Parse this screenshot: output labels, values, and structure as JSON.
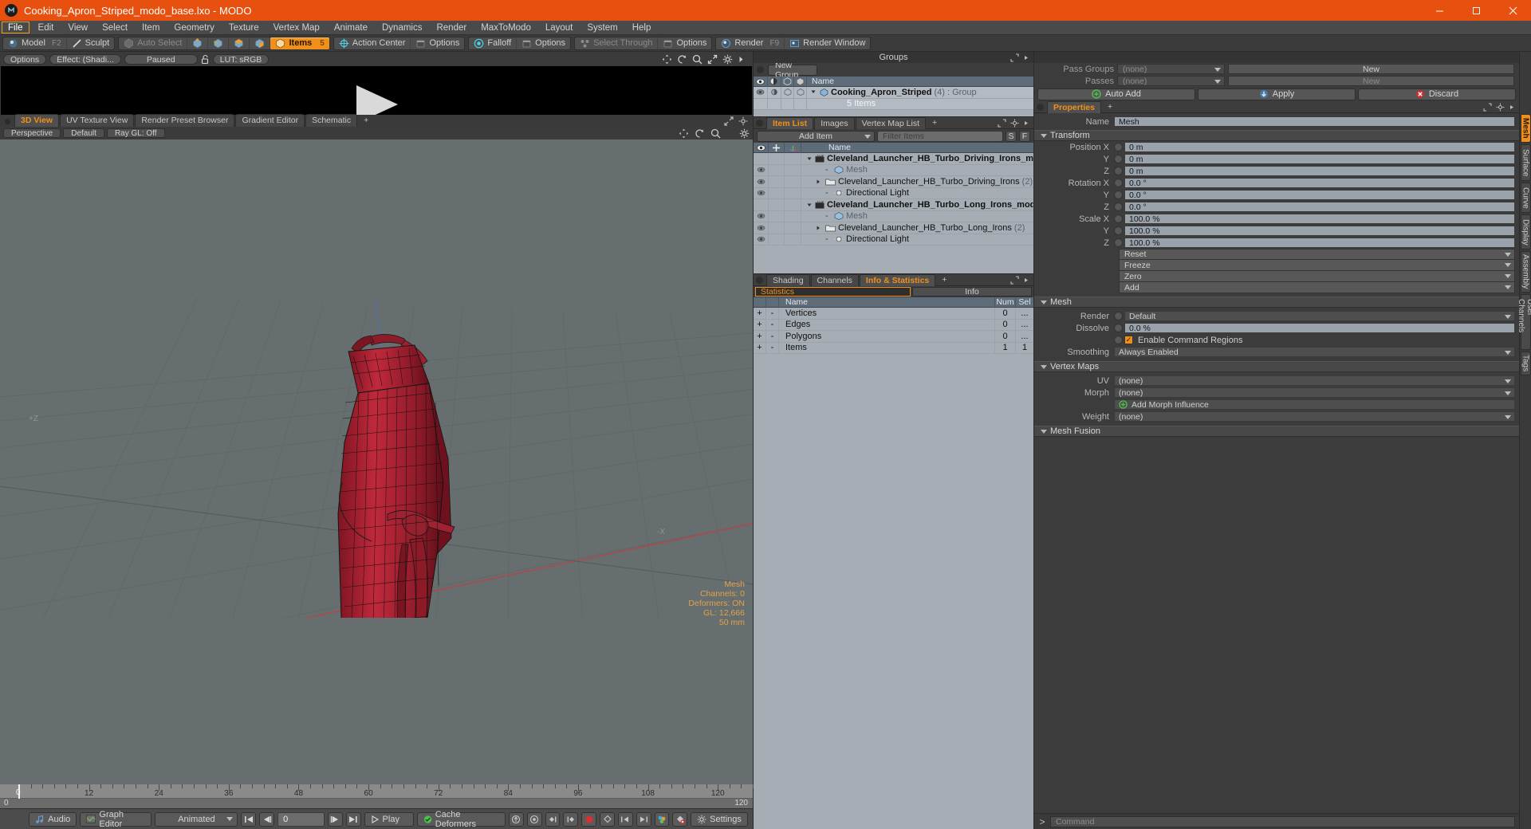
{
  "window": {
    "title": "Cooking_Apron_Striped_modo_base.lxo - MODO",
    "minimize": "–",
    "maximize": "❐",
    "close": "✕"
  },
  "menu": {
    "items": [
      "File",
      "Edit",
      "View",
      "Select",
      "Item",
      "Geometry",
      "Texture",
      "Vertex Map",
      "Animate",
      "Dynamics",
      "Render",
      "MaxToModo",
      "Layout",
      "System",
      "Help"
    ],
    "active": "File"
  },
  "modebar": {
    "model": "Model",
    "model_key": "F2",
    "sculpt": "Sculpt",
    "auto_select": "Auto Select",
    "items": "Items",
    "items_count": "5",
    "action_center": "Action Center",
    "options1": "Options",
    "falloff": "Falloff",
    "options2": "Options",
    "select_through": "Select Through",
    "options3": "Options",
    "render": "Render",
    "render_key": "F9",
    "render_window": "Render Window"
  },
  "render_preview": {
    "options": "Options",
    "effect": "Effect: (Shadi...",
    "paused": "Paused",
    "lut": "LUT: sRGB"
  },
  "viewport_tabs": {
    "tabs": [
      "3D View",
      "UV Texture View",
      "Render Preset Browser",
      "Gradient Editor",
      "Schematic"
    ],
    "selected": "3D View",
    "plus": "+"
  },
  "viewport_header": {
    "perspective": "Perspective",
    "shading_default": "Default",
    "raygl": "Ray GL: Off"
  },
  "viewport": {
    "axis_label_z": "+Z",
    "axis_label_x": "-X",
    "status_title": "Mesh",
    "status_lines": [
      "Channels: 0",
      "Deformers: ON",
      "GL: 12,666",
      "50 mm"
    ]
  },
  "timeline": {
    "ticks": [
      {
        "value": "0",
        "pos": 0
      },
      {
        "value": "12",
        "pos": 12
      },
      {
        "value": "24",
        "pos": 24
      },
      {
        "value": "36",
        "pos": 36
      },
      {
        "value": "48",
        "pos": 48
      },
      {
        "value": "60",
        "pos": 60
      },
      {
        "value": "72",
        "pos": 72
      },
      {
        "value": "84",
        "pos": 84
      },
      {
        "value": "96",
        "pos": 96
      },
      {
        "value": "108",
        "pos": 108
      },
      {
        "value": "120",
        "pos": 120
      }
    ],
    "range_start": "0",
    "range_end": "120",
    "playhead": "0"
  },
  "bottombar": {
    "audio": "Audio",
    "graph_editor": "Graph Editor",
    "mode": "Animated",
    "frame": "0",
    "play": "Play",
    "cache_deformers": "Cache Deformers",
    "settings": "Settings"
  },
  "groups_panel": {
    "title": "Groups",
    "new_group": "New Group",
    "columns": [
      "Name"
    ],
    "item_name": "Cooking_Apron_Striped",
    "item_count": "(4)",
    "item_type": ": Group",
    "item_sub": "5 Items"
  },
  "item_list": {
    "tabs": [
      "Item List",
      "Images",
      "Vertex Map List"
    ],
    "selected": "Item List",
    "plus": "+",
    "add_item": "Add Item",
    "filter_placeholder": "Filter Items",
    "filter_s": "S",
    "filter_f": "F",
    "columns": [
      "Name"
    ],
    "rows": [
      {
        "name": "Cleveland_Launcher_HB_Turbo_Driving_Irons_modo_base ...",
        "type": "scene",
        "indent": 0,
        "expanded": true,
        "eye": false
      },
      {
        "name": "Mesh",
        "type": "mesh",
        "indent": 2,
        "grey": true,
        "eye": true
      },
      {
        "name": "Cleveland_Launcher_HB_Turbo_Driving_Irons",
        "suffix": "(2)",
        "type": "folder",
        "indent": 1,
        "eye": true
      },
      {
        "name": "Directional Light",
        "type": "light",
        "indent": 2,
        "eye": true
      },
      {
        "name": "Cleveland_Launcher_HB_Turbo_Long_Irons_modo_base.lxo",
        "type": "scene",
        "indent": 0,
        "expanded": true,
        "eye": false
      },
      {
        "name": "Mesh",
        "type": "mesh",
        "indent": 2,
        "grey": true,
        "eye": true
      },
      {
        "name": "Cleveland_Launcher_HB_Turbo_Long_Irons",
        "suffix": "(2)",
        "type": "folder",
        "indent": 1,
        "eye": true
      },
      {
        "name": "Directional Light",
        "type": "light",
        "indent": 2,
        "eye": true
      }
    ]
  },
  "info_panel": {
    "tabs": [
      "Shading",
      "Channels",
      "Info & Statistics"
    ],
    "selected": "Info & Statistics",
    "plus": "+",
    "statistics_tab": "Statistics",
    "info_tab": "Info",
    "columns": [
      "Name",
      "Num",
      "Sel"
    ],
    "rows": [
      {
        "name": "Vertices",
        "num": "0",
        "sel": "..."
      },
      {
        "name": "Edges",
        "num": "0",
        "sel": "..."
      },
      {
        "name": "Polygons",
        "num": "0",
        "sel": "..."
      },
      {
        "name": "Items",
        "num": "1",
        "sel": "1"
      }
    ],
    "plus_sym": "+",
    "minus_sym": "-"
  },
  "passes": {
    "pass_groups_label": "Pass Groups",
    "pass_groups_value": "(none)",
    "passes_label": "Passes",
    "passes_value": "(none)",
    "new1": "New",
    "new2": "New",
    "auto_add": "Auto Add",
    "apply": "Apply",
    "discard": "Discard"
  },
  "properties": {
    "tab": "Properties",
    "plus": "+",
    "name_label": "Name",
    "name_value": "Mesh",
    "transform_header": "Transform",
    "transform_rows": [
      {
        "label": "Position X",
        "value": "0 m"
      },
      {
        "label": "Y",
        "value": "0 m"
      },
      {
        "label": "Z",
        "value": "0 m"
      },
      {
        "label": "Rotation X",
        "value": "0.0 °"
      },
      {
        "label": "Y",
        "value": "0.0 °"
      },
      {
        "label": "Z",
        "value": "0.0 °"
      },
      {
        "label": "Scale X",
        "value": "100.0 %"
      },
      {
        "label": "Y",
        "value": "100.0 %"
      },
      {
        "label": "Z",
        "value": "100.0 %"
      }
    ],
    "transform_buttons": [
      "Reset",
      "Freeze",
      "Zero",
      "Add"
    ],
    "mesh_header": "Mesh",
    "render_label": "Render",
    "render_value": "Default",
    "dissolve_label": "Dissolve",
    "dissolve_value": "0.0 %",
    "enable_command_regions": "Enable Command Regions",
    "smoothing_label": "Smoothing",
    "smoothing_value": "Always Enabled",
    "vertex_maps_header": "Vertex Maps",
    "uv_label": "UV",
    "uv_value": "(none)",
    "morph_label": "Morph",
    "morph_value": "(none)",
    "add_morph_influence": "Add Morph Influence",
    "weight_label": "Weight",
    "weight_value": "(none)",
    "mesh_fusion_header": "Mesh Fusion"
  },
  "right_vtabs": {
    "tabs": [
      "Mesh",
      "Surface",
      "Curve",
      "Display",
      "Assembly",
      "User Channels",
      "Tags"
    ],
    "selected": "Mesh"
  },
  "command": {
    "prompt": ">",
    "placeholder": "Command"
  },
  "colors": {
    "title_bar": "#e8500f",
    "accent": "#f0901a",
    "panel_bg": "#3a3a3a",
    "tree_bg": "#a6adb5",
    "viewport_bg": "#666e70",
    "mesh_red": "#b02030"
  }
}
